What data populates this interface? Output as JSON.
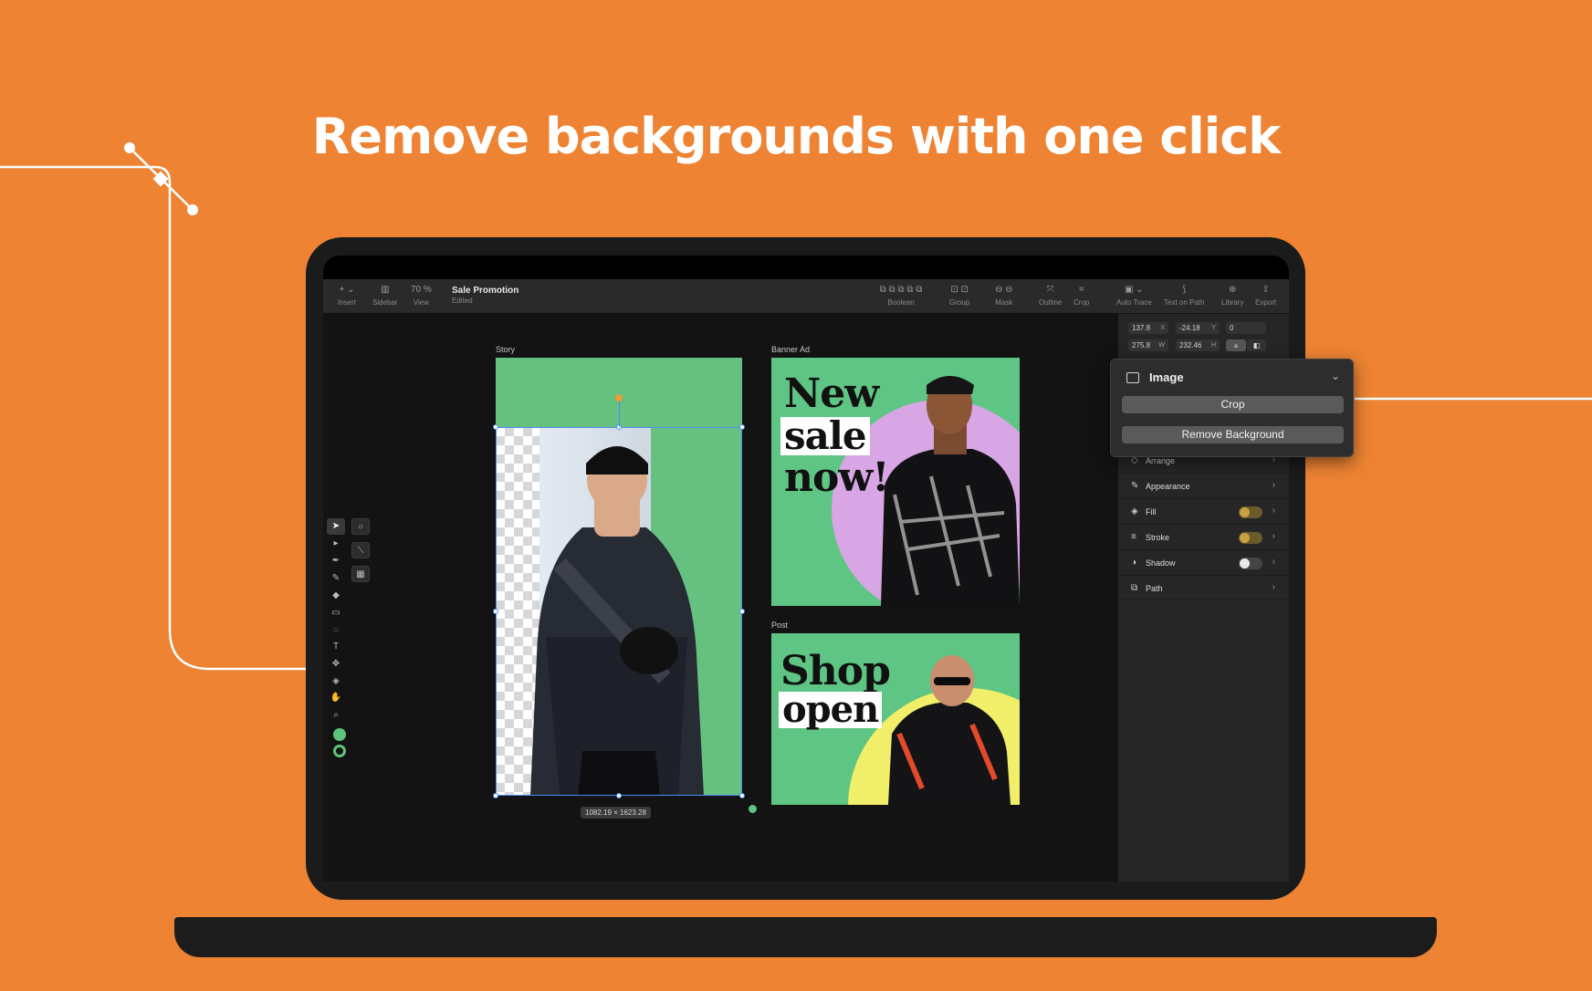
{
  "headline": "Remove backgrounds with one click",
  "colors": {
    "background": "#ED8333",
    "accent": "#5ec584",
    "selection": "#4b8cf5"
  },
  "toolbar": {
    "doc_title": "Sale Promotion",
    "doc_status": "Edited",
    "zoom": "70 %",
    "items": [
      {
        "label": "Insert",
        "icon": "plus-icon"
      },
      {
        "label": "Sidebar",
        "icon": "sidebar-icon"
      },
      {
        "label": "View",
        "icon": "view-icon"
      },
      {
        "label": "Boolean",
        "icon": "boolean-icon"
      },
      {
        "label": "Group",
        "icon": "group-icon"
      },
      {
        "label": "Mask",
        "icon": "mask-icon"
      },
      {
        "label": "Outline",
        "icon": "outline-icon"
      },
      {
        "label": "Crop",
        "icon": "crop-icon"
      },
      {
        "label": "Auto Trace",
        "icon": "auto-trace-icon"
      },
      {
        "label": "Text on Path",
        "icon": "text-on-path-icon"
      },
      {
        "label": "Library",
        "icon": "library-icon"
      },
      {
        "label": "Export",
        "icon": "export-icon"
      }
    ]
  },
  "artboards": {
    "story": {
      "label": "Story",
      "dimensions": "1082.19 × 1623.28"
    },
    "banner": {
      "label": "Banner Ad",
      "text": [
        "New",
        "sale",
        "now!"
      ]
    },
    "post": {
      "label": "Post",
      "text": [
        "Shop",
        "open"
      ]
    }
  },
  "inspector": {
    "x": "137.8",
    "x_unit": "X",
    "y": "-24.18",
    "y_unit": "Y",
    "rotation": "0",
    "w": "275.8",
    "w_unit": "W",
    "h": "232.46",
    "h_unit": "H",
    "rows": [
      {
        "label": "Arrange",
        "icon": "arrange-icon"
      },
      {
        "label": "Appearance",
        "icon": "appearance-icon"
      },
      {
        "label": "Fill",
        "icon": "fill-icon",
        "toggle": "on"
      },
      {
        "label": "Stroke",
        "icon": "stroke-icon",
        "toggle": "on"
      },
      {
        "label": "Shadow",
        "icon": "shadow-icon",
        "toggle": "off"
      },
      {
        "label": "Path",
        "icon": "path-icon"
      }
    ]
  },
  "popover": {
    "title": "Image",
    "icon": "image-icon",
    "crop_label": "Crop",
    "remove_bg_label": "Remove Background"
  },
  "help_label": "?"
}
